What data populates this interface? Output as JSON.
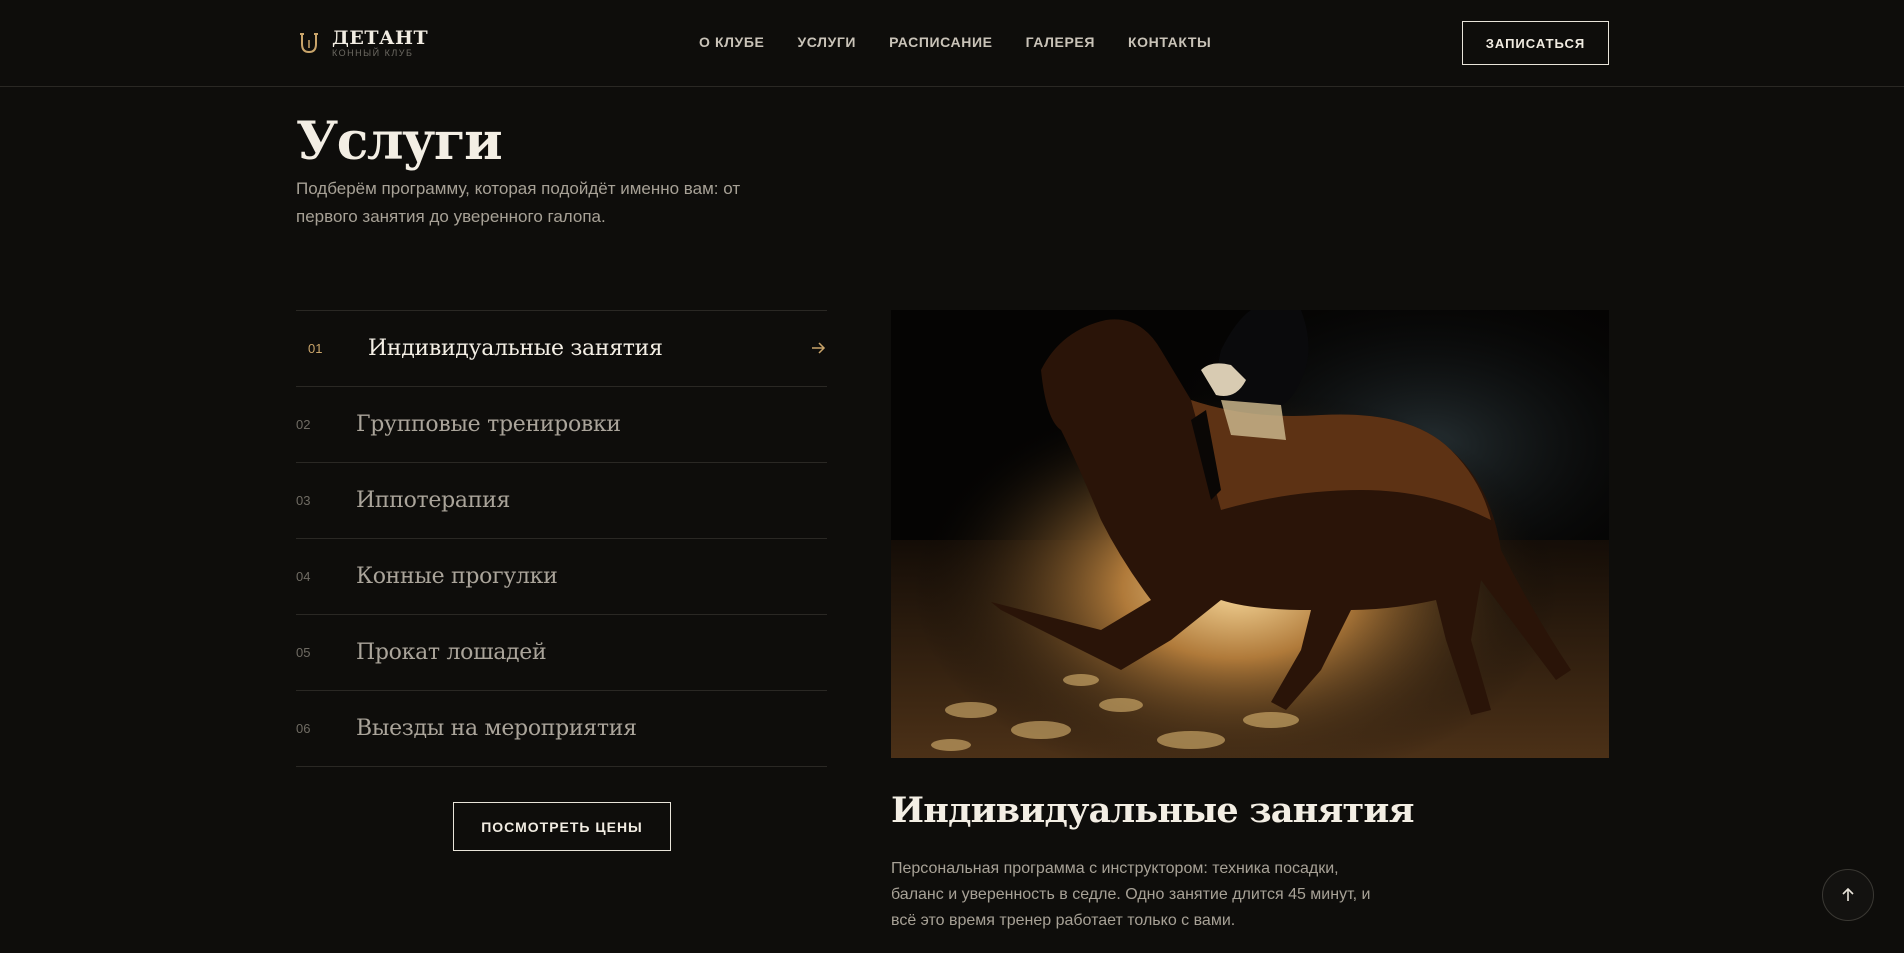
{
  "header": {
    "logo_name": "ДЕТАНТ",
    "logo_sub": "КОННЫЙ КЛУБ",
    "nav": [
      "О КЛУБЕ",
      "УСЛУГИ",
      "РАСПИСАНИЕ",
      "ГАЛЕРЕЯ",
      "КОНТАКТЫ"
    ],
    "signup_label": "ЗАПИСАТЬСЯ"
  },
  "page": {
    "title": "Услуги",
    "subtitle": "Подберём программу, которая подойдёт именно вам: от первого занятия до уверенного галопа."
  },
  "services": [
    {
      "num": "01",
      "title": "Индивидуальные занятия",
      "active": true
    },
    {
      "num": "02",
      "title": "Групповые тренировки",
      "active": false
    },
    {
      "num": "03",
      "title": "Иппотерапия",
      "active": false
    },
    {
      "num": "04",
      "title": "Конные прогулки",
      "active": false
    },
    {
      "num": "05",
      "title": "Прокат лошадей",
      "active": false
    },
    {
      "num": "06",
      "title": "Выезды на мероприятия",
      "active": false
    }
  ],
  "prices_label": "ПОСМОТРЕТЬ ЦЕНЫ",
  "detail": {
    "title": "Индивидуальные занятия",
    "text": "Персональная программа с инструктором: техника посадки, баланс и уверенность в седле. Одно занятие длится 45 минут, и всё это время тренер работает только с вами."
  },
  "icons": {
    "logo": "horseshoe-icon",
    "active_arrow": "arrow-right-icon",
    "to_top": "arrow-up-icon"
  },
  "colors": {
    "background": "#0e0d0b",
    "accent": "#c9a46a",
    "text": "#f3eee4",
    "muted": "#a7a196"
  }
}
